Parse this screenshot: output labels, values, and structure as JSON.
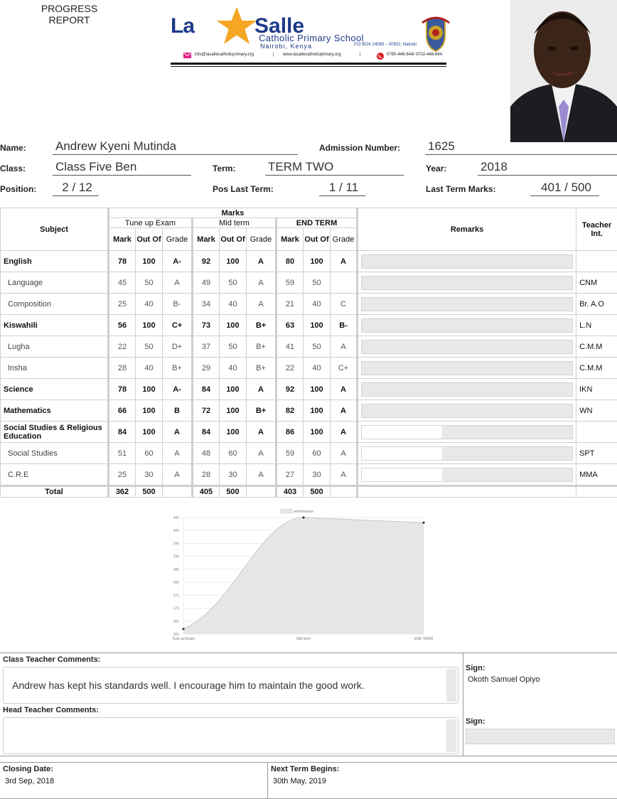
{
  "header": {
    "report_title_line1": "PROGRESS",
    "report_title_line2": "REPORT",
    "logo_la": "La",
    "logo_salle": "Salle",
    "logo_subtitle": "Catholic Primary School",
    "logo_location": "Nairobi, Kenya",
    "logo_box": "P.O BOX 24083 – 00502, Nairobi",
    "email": "info@lasallecatholicprimary.org",
    "website": "www.lasallecatholicprimary.org",
    "phone": "0780-446-644/ 0702-446-644",
    "crest_motto": "INDIVISA MANENT"
  },
  "student": {
    "name_label": "Name:",
    "name": "Andrew Kyeni Mutinda",
    "adm_label": "Admission Number:",
    "adm": "1625",
    "class_label": "Class:",
    "class": "Class Five Ben",
    "term_label": "Term:",
    "term": "TERM TWO",
    "year_label": "Year:",
    "year": "2018",
    "position_label": "Position:",
    "position": "2 / 12",
    "pos_last_label": "Pos Last Term:",
    "pos_last": "1 / 11",
    "last_marks_label": "Last Term Marks:",
    "last_marks": "401 / 500"
  },
  "table": {
    "subject_h": "Subject",
    "marks_h": "Marks",
    "remarks_h": "Remarks",
    "teacher_h": "Teacher Int.",
    "exam1": "Tune up Exam",
    "exam2": "Mid term",
    "exam3": "END TERM",
    "mark_h": "Mark",
    "outof_h": "Out Of",
    "grade_h": "Grade",
    "total_label": "Total",
    "rows": [
      {
        "subject": "English",
        "main": true,
        "m1": "78",
        "o1": "100",
        "g1": "A-",
        "m2": "92",
        "o2": "100",
        "g2": "A",
        "m3": "80",
        "o3": "100",
        "g3": "A",
        "teacher": ""
      },
      {
        "subject": "Language",
        "main": false,
        "m1": "45",
        "o1": "50",
        "g1": "A",
        "m2": "49",
        "o2": "50",
        "g2": "A",
        "m3": "59",
        "o3": "50",
        "g3": "",
        "teacher": "CNM"
      },
      {
        "subject": "Composition",
        "main": false,
        "m1": "25",
        "o1": "40",
        "g1": "B-",
        "m2": "34",
        "o2": "40",
        "g2": "A",
        "m3": "21",
        "o3": "40",
        "g3": "C",
        "teacher": "Br. A.O"
      },
      {
        "subject": "Kiswahili",
        "main": true,
        "m1": "56",
        "o1": "100",
        "g1": "C+",
        "m2": "73",
        "o2": "100",
        "g2": "B+",
        "m3": "63",
        "o3": "100",
        "g3": "B-",
        "teacher": "L.N"
      },
      {
        "subject": "Lugha",
        "main": false,
        "m1": "22",
        "o1": "50",
        "g1": "D+",
        "m2": "37",
        "o2": "50",
        "g2": "B+",
        "m3": "41",
        "o3": "50",
        "g3": "A",
        "teacher": "C.M.M"
      },
      {
        "subject": "Insha",
        "main": false,
        "m1": "28",
        "o1": "40",
        "g1": "B+",
        "m2": "29",
        "o2": "40",
        "g2": "B+",
        "m3": "22",
        "o3": "40",
        "g3": "C+",
        "teacher": "C.M.M"
      },
      {
        "subject": "Science",
        "main": true,
        "m1": "78",
        "o1": "100",
        "g1": "A-",
        "m2": "84",
        "o2": "100",
        "g2": "A",
        "m3": "92",
        "o3": "100",
        "g3": "A",
        "teacher": "IKN"
      },
      {
        "subject": "Mathematics",
        "main": true,
        "m1": "66",
        "o1": "100",
        "g1": "B",
        "m2": "72",
        "o2": "100",
        "g2": "B+",
        "m3": "82",
        "o3": "100",
        "g3": "A",
        "teacher": "WN"
      },
      {
        "subject": "Social Studies & Religious Education",
        "main": true,
        "m1": "84",
        "o1": "100",
        "g1": "A",
        "m2": "84",
        "o2": "100",
        "g2": "A",
        "m3": "86",
        "o3": "100",
        "g3": "A",
        "teacher": ""
      },
      {
        "subject": "Social Studies",
        "main": false,
        "m1": "51",
        "o1": "60",
        "g1": "A",
        "m2": "48",
        "o2": "60",
        "g2": "A",
        "m3": "59",
        "o3": "60",
        "g3": "A",
        "teacher": "SPT"
      },
      {
        "subject": "C.R.E",
        "main": false,
        "m1": "25",
        "o1": "30",
        "g1": "A",
        "m2": "28",
        "o2": "30",
        "g2": "A",
        "m3": "27",
        "o3": "30",
        "g3": "A",
        "teacher": "MMA"
      }
    ],
    "totals": {
      "m1": "362",
      "o1": "500",
      "m2": "405",
      "o2": "500",
      "m3": "403",
      "o3": "500"
    }
  },
  "chart_data": {
    "type": "area",
    "categories": [
      "Tune up Exam",
      "Mid term",
      "END TERM"
    ],
    "series": [
      {
        "name": "performance",
        "values": [
          362,
          405,
          403
        ]
      }
    ],
    "ylim": [
      360,
      405
    ],
    "yticks": [
      360,
      365,
      370,
      375,
      380,
      385,
      390,
      395,
      400,
      405
    ],
    "legend": "top",
    "grid": true,
    "colors": {
      "fill": "#e6e6e6",
      "line": "#c8c8c8",
      "point": "#333333"
    }
  },
  "comments": {
    "class_teacher_label": "Class Teacher Comments:",
    "class_teacher_text": "Andrew has kept his standards well.  I encourage him to maintain the good work.",
    "head_teacher_label": "Head Teacher Comments:",
    "head_teacher_text": "",
    "sign1_label": "Sign:",
    "sign1_name": "Okoth Samuel Opiyo",
    "sign2_label": "Sign:"
  },
  "footer": {
    "closing_label": "Closing Date:",
    "closing": "3rd Sep, 2018",
    "next_label": "Next Term Begins:",
    "next": "30th May, 2019"
  }
}
